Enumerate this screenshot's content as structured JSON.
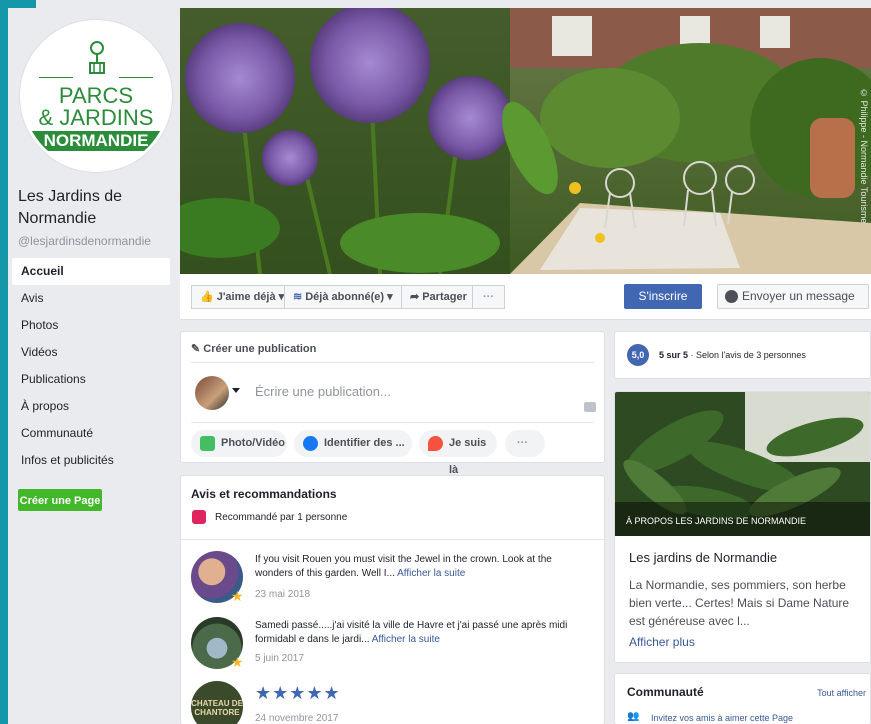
{
  "page": {
    "logo": {
      "line1": "PARCS",
      "line2": "& JARDINS",
      "line3": "NORMANDIE"
    },
    "name": "Les Jardins de Normandie",
    "handle": "@lesjardinsdenormandie",
    "photo_credit": "© Philippe - Normandie Tourisme"
  },
  "nav": {
    "items": [
      "Accueil",
      "Avis",
      "Photos",
      "Vidéos",
      "Publications",
      "À propos",
      "Communauté",
      "Infos et publicités"
    ],
    "create_page": "Créer une Page"
  },
  "actions": {
    "like": "J'aime déjà",
    "follow": "Déjà abonné(e)",
    "share": "Partager",
    "more": "···",
    "signup": "S'inscrire",
    "message": "Envoyer un message"
  },
  "composer": {
    "header": "Créer une publication",
    "placeholder": "Écrire une publication...",
    "photo": "Photo/Vidéo",
    "tag": "Identifier des ...",
    "checkin": "Je suis là",
    "more": "···"
  },
  "reviews": {
    "title": "Avis et recommandations",
    "recommended": "Recommandé par 1 personne",
    "items": [
      {
        "text": "If you visit Rouen you must visit the Jewel in the crown. Look at the wonders of this garden. Well I...",
        "more": "Afficher la suite",
        "date": "23 mai 2018"
      },
      {
        "text": "Samedi passé.....j'ai visité la ville de Havre et j'ai passé une après midi formidabl e dans le jardi...",
        "more": "Afficher la suite",
        "date": "5 juin 2017"
      },
      {
        "stars": "★★★★★",
        "avatar_text": "CHATEAU DE CHANTORE",
        "date": "24 novembre 2017"
      }
    ]
  },
  "rating": {
    "badge": "5,0",
    "score": "5 sur 5",
    "detail": " · Selon l'avis de 3 personnes"
  },
  "about": {
    "caption": "À PROPOS LES JARDINS DE NORMANDIE",
    "title": "Les jardins de Normandie",
    "description": "La Normandie, ses pommiers, son herbe bien verte... Certes! Mais si Dame Nature est généreuse avec l...",
    "more": "Afficher plus"
  },
  "community": {
    "title": "Communauté",
    "see_all": "Tout afficher",
    "invite": "Invitez vos amis à aimer cette Page"
  }
}
